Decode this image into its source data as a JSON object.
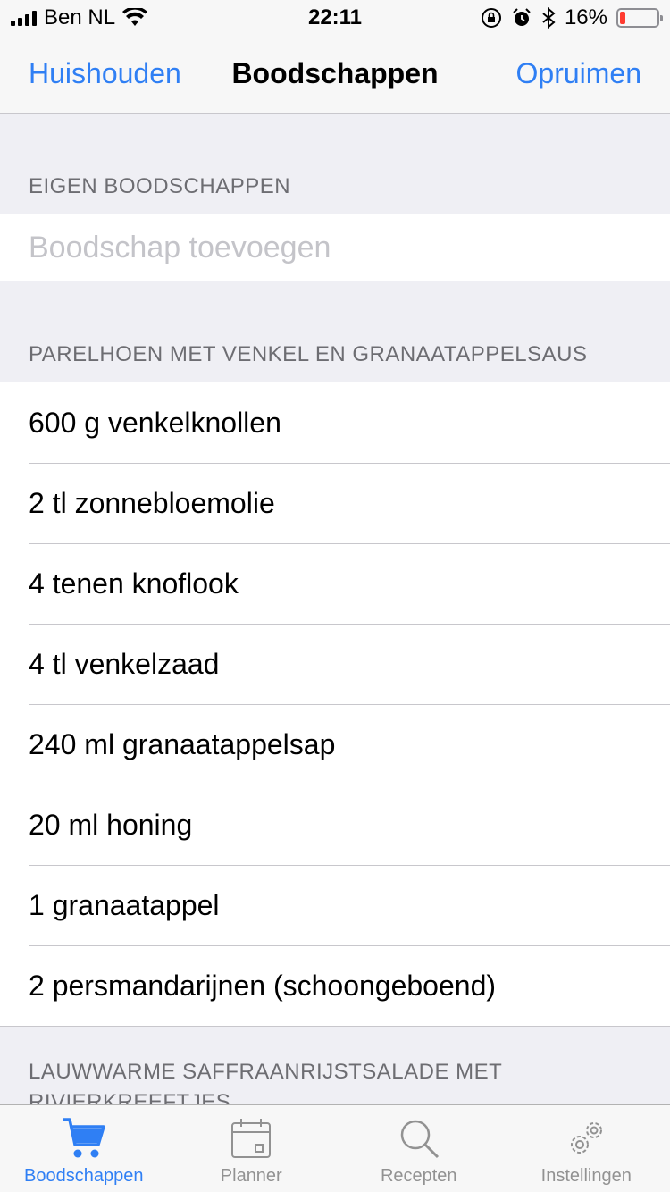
{
  "status_bar": {
    "carrier": "Ben NL",
    "time": "22:11",
    "battery_percent": "16%",
    "battery_level": 0.16
  },
  "nav": {
    "left_label": "Huishouden",
    "title": "Boodschappen",
    "right_label": "Opruimen"
  },
  "own_section": {
    "header": "EIGEN BOODSCHAPPEN",
    "input_placeholder": "Boodschap toevoegen",
    "input_value": ""
  },
  "recipe_section": {
    "header": "PARELHOEN MET VENKEL EN GRANAATAPPELSAUS",
    "items": [
      "600 g venkelknollen",
      "2 tl zonnebloemolie",
      "4 tenen knoflook",
      "4 tl venkelzaad",
      "240 ml granaatappelsap",
      "20 ml honing",
      "1 granaatappel",
      "2 persmandarijnen (schoongeboend)"
    ]
  },
  "next_section": {
    "header": "LAUWWARME SAFFRAANRIJSTSALADE MET RIVIERKREEFTJES"
  },
  "tabs": [
    {
      "label": "Boodschappen",
      "icon": "cart-icon",
      "active": true
    },
    {
      "label": "Planner",
      "icon": "calendar-icon",
      "active": false
    },
    {
      "label": "Recepten",
      "icon": "search-icon",
      "active": false
    },
    {
      "label": "Instellingen",
      "icon": "gears-icon",
      "active": false
    }
  ],
  "colors": {
    "accent": "#2f7ff4",
    "inactive_tab": "#929292",
    "battery_low": "#ff3b30",
    "background": "#efeff4"
  }
}
